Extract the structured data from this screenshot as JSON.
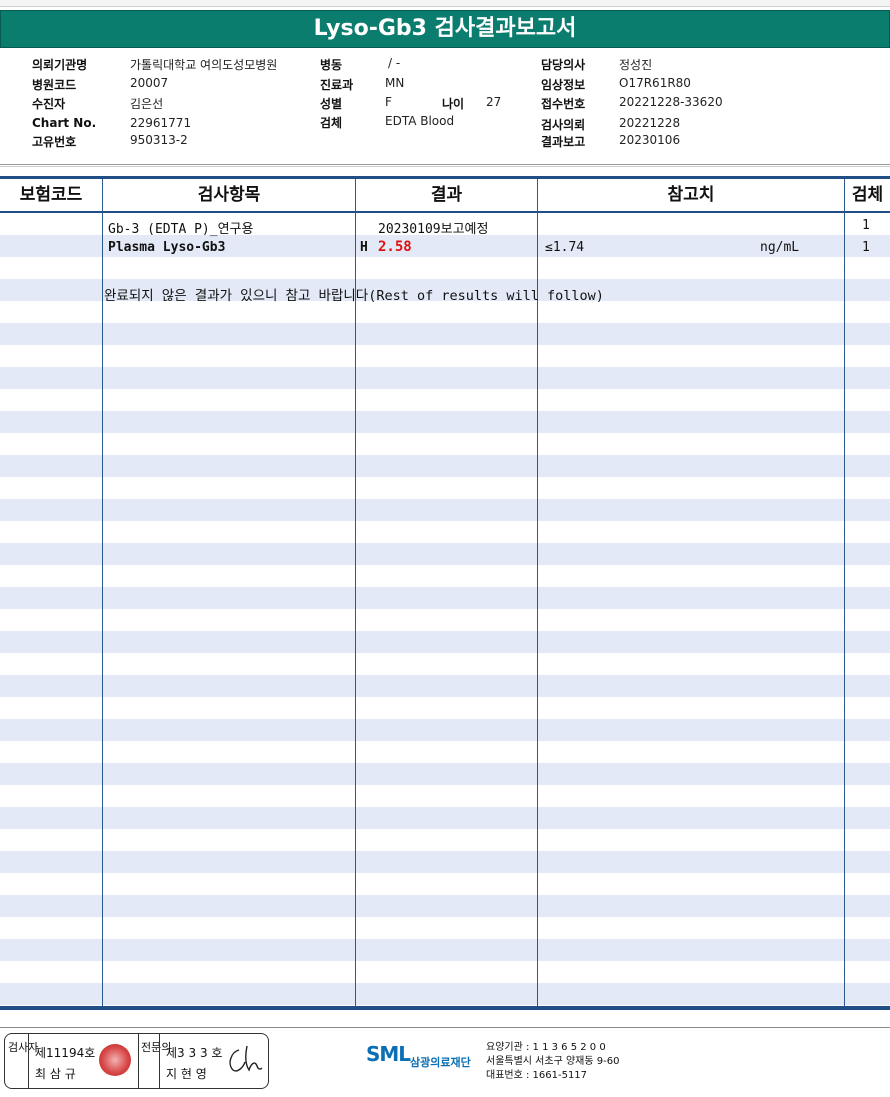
{
  "title": "Lyso-Gb3 검사결과보고서",
  "info": {
    "institution_label": "의뢰기관명",
    "institution": "가톨릭대학교 여의도성모병원",
    "hospital_code_label": "병원코드",
    "hospital_code": "20007",
    "patient_label": "수진자",
    "patient": "김은선",
    "chart_label": "Chart No.",
    "chart": "22961771",
    "id_label": "고유번호",
    "id": "950313-2",
    "ward_label": "병동",
    "ward": "/ -",
    "dept_label": "진료과",
    "dept": "MN",
    "sex_label": "성별",
    "sex": "F",
    "age_label": "나이",
    "age": "27",
    "specimen_label": "검체",
    "specimen": "EDTA Blood",
    "doctor_label": "담당의사",
    "doctor": "정성진",
    "clinical_label": "임상정보",
    "clinical": "O17R61R80",
    "receipt_label": "접수번호",
    "receipt": "20221228-33620",
    "request_label": "검사의뢰",
    "request": "20221228",
    "report_label": "결과보고",
    "report": "20230106"
  },
  "table": {
    "headers": [
      "보험코드",
      "검사항목",
      "결과",
      "참고치",
      "검체"
    ],
    "rows": [
      {
        "item": "Gb-3 (EDTA P)_연구용",
        "flag": "",
        "result": "20230109보고예정",
        "ref": "",
        "unit": "",
        "specimen": "1"
      },
      {
        "item": "Plasma Lyso-Gb3",
        "flag": "H",
        "result": "2.58",
        "ref": "≤1.74",
        "unit": "ng/mL",
        "specimen": "1"
      }
    ],
    "note": "완료되지  않은  결과가  있으니  참고  바랍니다(Rest of results will follow)"
  },
  "footer": {
    "tester_label": "검사자",
    "tester_no": "제11194호",
    "tester_name": "최 삼 규",
    "specialist_label": "전문의",
    "specialist_no": "제3 3 3 호",
    "specialist_name": "지 현 영",
    "logo": "SML",
    "foundation": "삼광의료재단",
    "line1": "요양기관 : 1 1 3 6 5 2 0 0",
    "line2": "서울특별시 서초구 양재동 9-60",
    "line3": "대표번호 : 1661-5117"
  },
  "colors": {
    "title_bg": "#0b7d6f",
    "stripe": "#e3e9f6",
    "rule": "#1f4f86",
    "flag_red": "#e01010"
  }
}
